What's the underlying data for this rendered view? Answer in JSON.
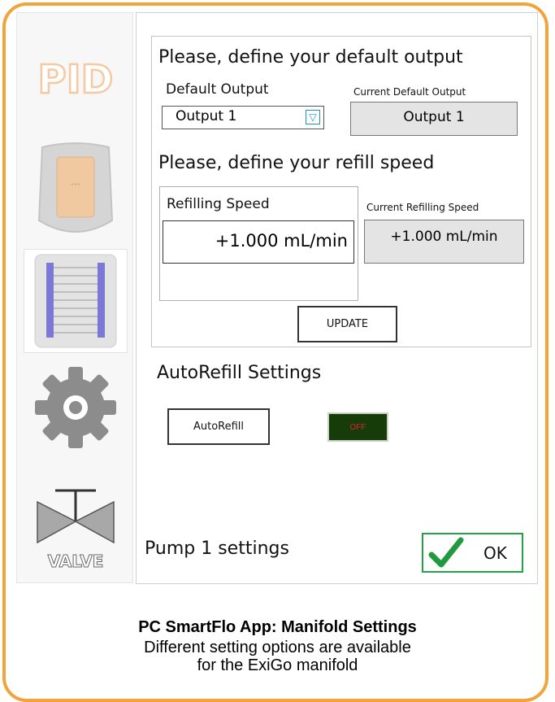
{
  "sidebar": {
    "items": [
      {
        "name": "pid",
        "label": "PID",
        "icon": "pid-icon"
      },
      {
        "name": "pump",
        "label": "",
        "icon": "pump-device-icon"
      },
      {
        "name": "manifold",
        "label": "",
        "icon": "manifold-icon"
      },
      {
        "name": "settings",
        "label": "",
        "icon": "gear-icon"
      },
      {
        "name": "valve",
        "label": "VALVE",
        "icon": "valve-icon"
      }
    ],
    "selected": "manifold"
  },
  "default_output": {
    "heading": "Please, define your default output",
    "label": "Default Output",
    "selected": "Output 1",
    "current_label": "Current Default Output",
    "current_value": "Output 1"
  },
  "refill": {
    "heading": "Please, define your refill speed",
    "label": "Refilling Speed",
    "value": "+1.000 mL/min",
    "current_label": "Current Refilling Speed",
    "current_value": "+1.000 mL/min",
    "update_label": "UPDATE"
  },
  "autorefill": {
    "heading": "AutoRefill Settings",
    "button_label": "AutoRefill",
    "toggle_label": "OFF",
    "toggle_state": "off"
  },
  "footer": {
    "title": "Pump 1 settings",
    "ok_label": "OK"
  },
  "caption": {
    "title": "PC SmartFlo App: Manifold Settings",
    "line1": "Different setting options are available",
    "line2": "for the ExiGo manifold"
  },
  "colors": {
    "frame": "#f2a33a",
    "pid_text": "#f5c9a1",
    "ok_border": "#22a34a",
    "toggle_bg": "#163c0a",
    "toggle_text": "#e0203a",
    "dropdown_accent": "#1e8fd0"
  }
}
